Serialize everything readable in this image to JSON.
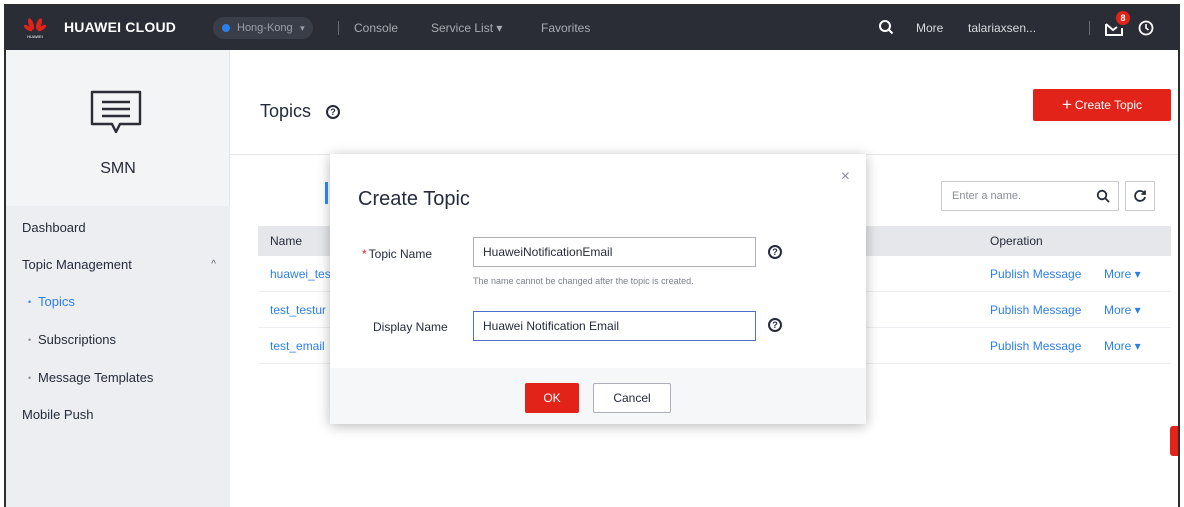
{
  "topbar": {
    "brand": "HUAWEI CLOUD",
    "logo_text": "HUAWEI",
    "region": "Hong-Kong",
    "links": [
      "Console",
      "Service List ▾",
      "Favorites"
    ],
    "more": "More",
    "user": "talariaxsen...",
    "notification_count": "8"
  },
  "sidebar": {
    "service_title": "SMN",
    "items": [
      {
        "label": "Dashboard"
      },
      {
        "label": "Topic Management"
      },
      {
        "label": "Topics"
      },
      {
        "label": "Subscriptions"
      },
      {
        "label": "Message Templates"
      },
      {
        "label": "Mobile Push"
      }
    ]
  },
  "page": {
    "title": "Topics",
    "create_button": "Create Topic",
    "search_placeholder": "Enter a name.",
    "columns": {
      "name": "Name",
      "operation": "Operation"
    },
    "rows": [
      {
        "name": "huawei_tes",
        "op": "Publish Message",
        "more": "More ▾"
      },
      {
        "name": "test_testur",
        "op": "Publish Message",
        "more": "More ▾"
      },
      {
        "name": "test_email",
        "op": "Publish Message",
        "more": "More ▾"
      }
    ]
  },
  "dialog": {
    "title": "Create Topic",
    "close": "×",
    "topic_name_label": "Topic Name",
    "topic_name_value": "HuaweiNotificationEmail",
    "topic_name_hint": "The name cannot be changed after the topic is created.",
    "display_name_label": "Display Name",
    "display_name_value": "Huawei Notification Email",
    "ok": "OK",
    "cancel": "Cancel"
  },
  "colors": {
    "accent": "#e2231a",
    "link": "#2d7fe8",
    "nav_bg": "#2a2d35"
  }
}
